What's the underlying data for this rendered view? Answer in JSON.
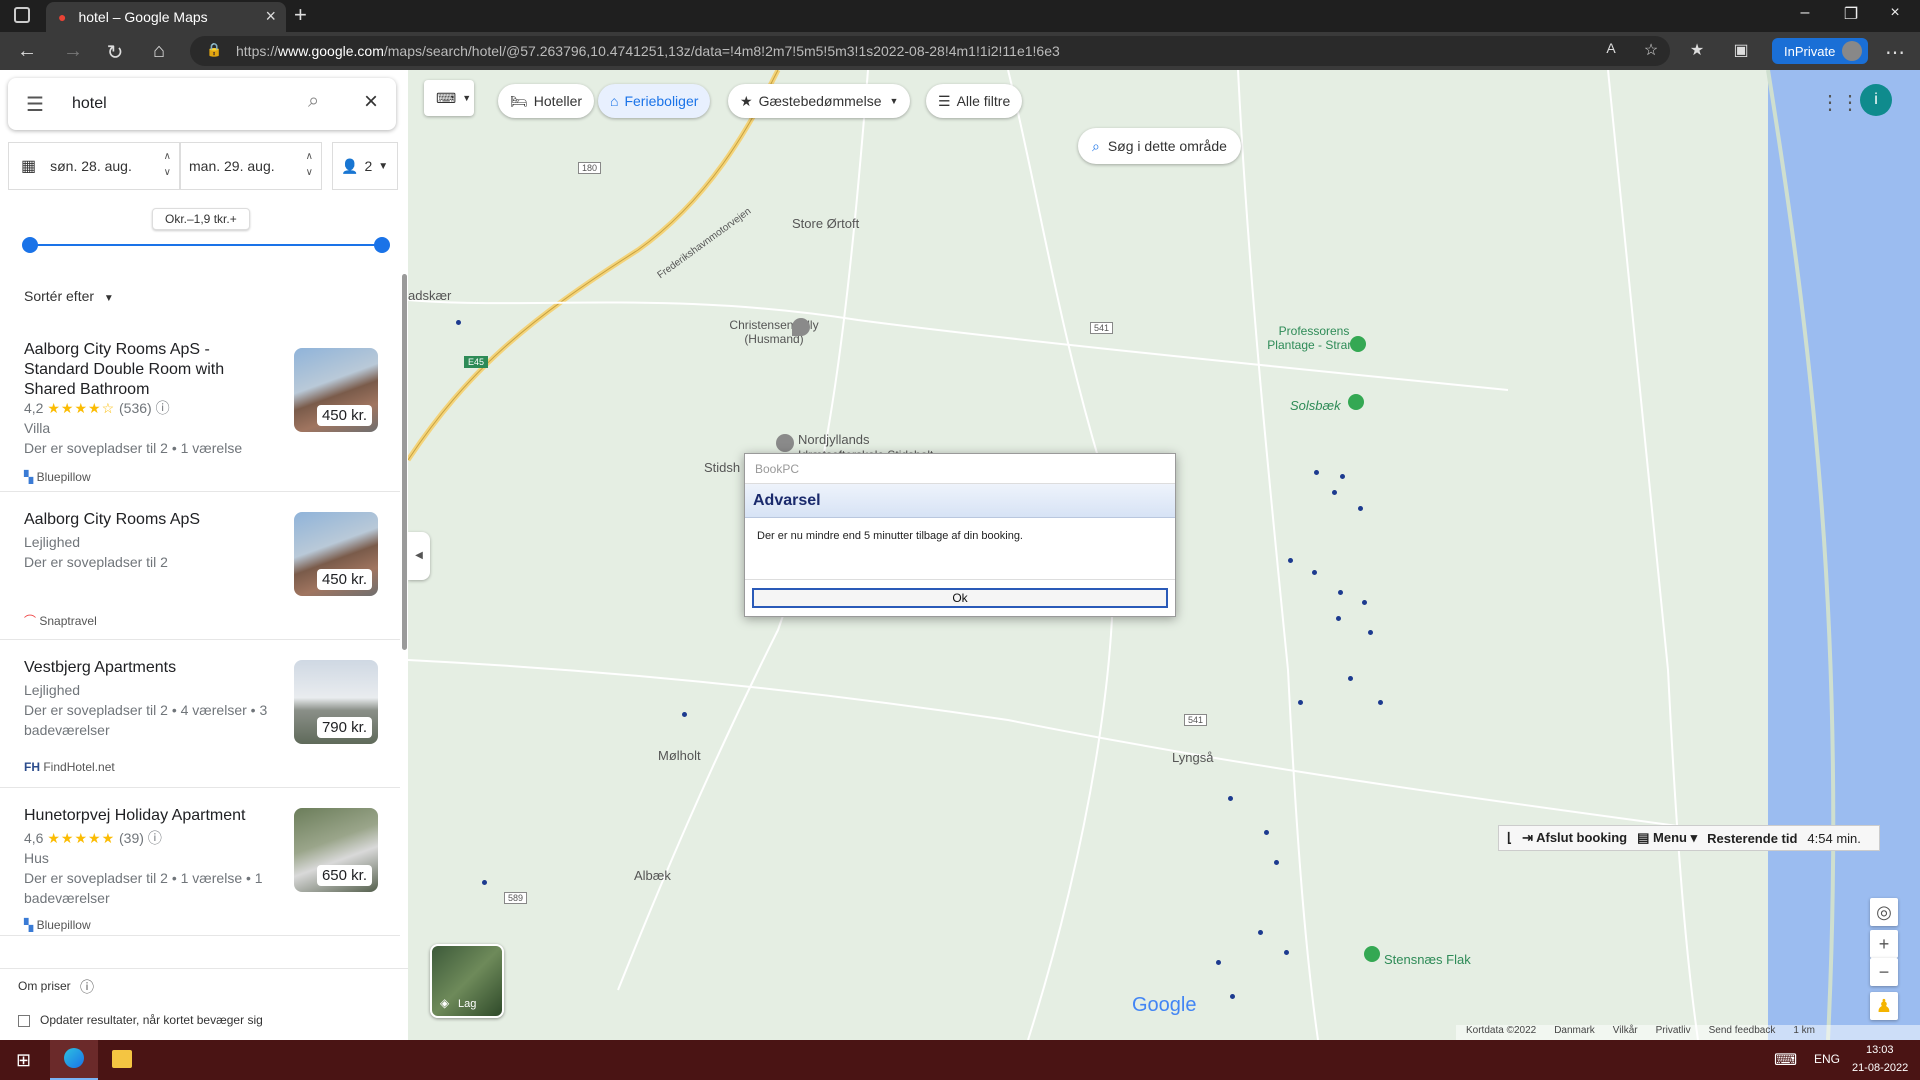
{
  "browser": {
    "tab_title": "hotel – Google Maps",
    "url_prefix": "https://",
    "url_host": "www.google.com",
    "url_path": "/maps/search/hotel/@57.263796,10.4741251,13z/data=!4m8!2m7!5m5!5m3!1s2022-08-28!4m1!1i2!11e1!6e3",
    "inprivate_label": "InPrivate"
  },
  "search": {
    "query": "hotel"
  },
  "dates": {
    "checkin": "søn. 28. aug.",
    "checkout": "man. 29. aug.",
    "guests": "2"
  },
  "price_slider": {
    "label": "Okr.–1,9 tkr.+",
    "low_fraction": 0,
    "high_fraction": 1
  },
  "sort": {
    "label": "Sortér efter"
  },
  "results": [
    {
      "title": "Aalborg City Rooms ApS - Standard Double Room with Shared Bathroom",
      "rating": "4,2",
      "stars": "★★★★☆",
      "reviews": "(536)",
      "type": "Villa",
      "details": "Der er sovepladser til 2 • 1 værelse",
      "source": "Bluepillow",
      "price": "450 kr."
    },
    {
      "title": "Aalborg City Rooms ApS",
      "type": "Lejlighed",
      "details": "Der er sovepladser til 2",
      "source": "Snaptravel",
      "price": "450 kr."
    },
    {
      "title": "Vestbjerg Apartments",
      "type": "Lejlighed",
      "details": "Der er sovepladser til 2 • 4 værelser • 3 badeværelser",
      "source": "FindHotel.net",
      "price": "790 kr."
    },
    {
      "title": "Hunetorpvej Holiday Apartment",
      "rating": "4,6",
      "stars": "★★★★★",
      "reviews": "(39)",
      "type": "Hus",
      "details": "Der er sovepladser til 2 • 1 værelse • 1 badeværelser",
      "source": "Bluepillow",
      "price": "650 kr."
    }
  ],
  "footer": {
    "about_prices": "Om priser",
    "update_checkbox": "Opdater resultater, når kortet bevæger sig"
  },
  "filters": {
    "hotels": "Hoteller",
    "vacation": "Ferieboliger",
    "rating": "Gæstebedømmelse",
    "all": "Alle filtre",
    "search_area": "Søg i dette område"
  },
  "map_labels": {
    "store_ortoft": "Store Ørtoft",
    "christensen": "Christensen Villy (Husmand)",
    "nordjyllands": "Nordjyllands",
    "nordjyllands2": "Idrætsefterskole Stidsholt",
    "stidsh": "Stidsh",
    "adskaer": "adskær",
    "professorens": "Professorens Plantage - Strand",
    "solsbaek": "Solsbæk",
    "molholt": "Mølholt",
    "lyngsa": "Lyngså",
    "albaek": "Albæk",
    "stensnaes": "Stensnæs Flak",
    "frederikshavn": "Frederikshavnmotorvejen",
    "road_180": "180",
    "road_541a": "541",
    "road_541b": "541",
    "road_589": "589",
    "road_e45": "E45",
    "layers": "Lag",
    "google": "Google"
  },
  "map_footer": {
    "kortdata": "Kortdata ©2022",
    "danmark": "Danmark",
    "vilkar": "Vilkår",
    "privatliv": "Privatliv",
    "feedback": "Send feedback",
    "scale": "1 km"
  },
  "dialog": {
    "caption": "BookPC",
    "header": "Advarsel",
    "message": "Der er nu mindre end 5 minutter tilbage af din booking.",
    "ok": "Ok"
  },
  "booking_bar": {
    "end": "Afslut booking",
    "menu": "Menu",
    "remaining_label": "Resterende tid",
    "remaining_value": "4:54 min."
  },
  "taskbar": {
    "lang": "ENG",
    "time": "13:03",
    "date": "21-08-2022"
  },
  "colors": {
    "accent": "#1a73e8",
    "sea": "#9bbcf0",
    "land": "#e5eee3",
    "taskbar": "#4a1414"
  }
}
